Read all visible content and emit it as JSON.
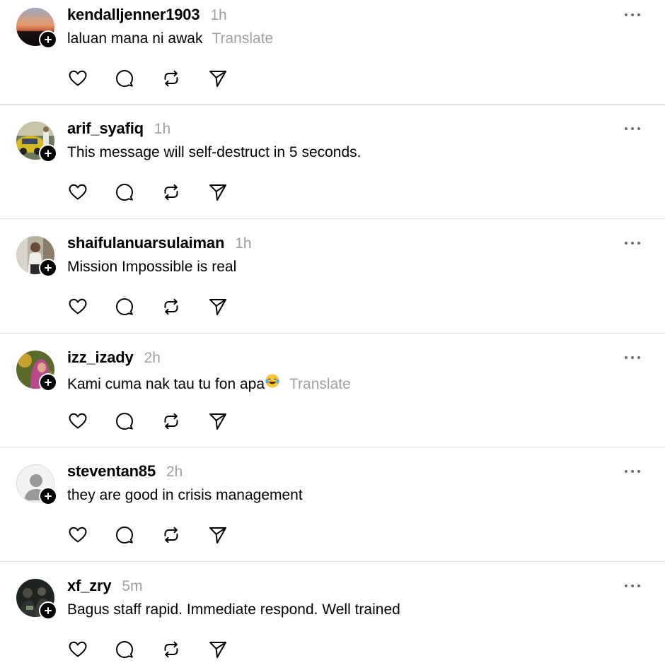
{
  "posts": [
    {
      "username": "kendalljenner1903",
      "time": "1h",
      "text": "laluan mana ni awak",
      "translate": "Translate",
      "avatar": "sunset-photo",
      "emoji": ""
    },
    {
      "username": "arif_syafiq",
      "time": "1h",
      "text": "This message will self-destruct in 5 seconds.",
      "translate": "",
      "avatar": "yellow-car-photo",
      "emoji": ""
    },
    {
      "username": "shaifulanuarsulaiman",
      "time": "1h",
      "text": "Mission Impossible is real",
      "translate": "",
      "avatar": "person-portrait-photo",
      "emoji": ""
    },
    {
      "username": "izz_izady",
      "time": "2h",
      "text": "Kami cuma nak tau tu fon apa",
      "translate": "Translate",
      "avatar": "woman-hijab-photo",
      "emoji": "laughing-tears-emoji"
    },
    {
      "username": "steventan85",
      "time": "2h",
      "text": "they are good in crisis management",
      "translate": "",
      "avatar": "default-person-avatar",
      "emoji": ""
    },
    {
      "username": "xf_zry",
      "time": "5m",
      "text": "Bagus staff rapid. Immediate respond. Well trained",
      "translate": "",
      "avatar": "dark-group-photo",
      "emoji": ""
    }
  ],
  "icons": {
    "follow": "plus-icon",
    "more": "more-dots-icon",
    "like": "heart-icon",
    "reply": "comment-bubble-icon",
    "repost": "repost-icon",
    "share": "send-icon"
  },
  "colors": {
    "text": "#000000",
    "muted": "#a0a0a0",
    "divider": "#dcdcdc",
    "badge": "#000000"
  }
}
